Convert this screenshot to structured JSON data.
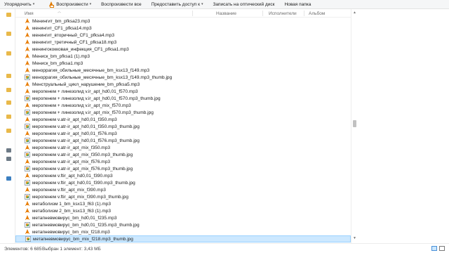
{
  "toolbar": {
    "organize": "Упорядочить",
    "play": "Воспроизвести",
    "play_all": "Воспроизвести все",
    "share": "Предоставить доступ к",
    "burn": "Записать на оптический диск",
    "new_folder": "Новая папка"
  },
  "columns": {
    "name": "Имя",
    "name2": "Название",
    "performers": "Исполнители",
    "album": "Альбом"
  },
  "files": [
    {
      "name": "Менингит_bm_pfksa23.mp3",
      "type": "mp3"
    },
    {
      "name": "менингит_CF1_pfksa14.mp3",
      "type": "mp3"
    },
    {
      "name": "менингит_вторичный_CF1_pfksa4.mp3",
      "type": "mp3"
    },
    {
      "name": "менингит_третичный_CF1_pfksa18.mp3",
      "type": "mp3"
    },
    {
      "name": "менингококковая_инфекция_CF1_pfksa1.mp3",
      "type": "mp3"
    },
    {
      "name": "Мениск_bm_pfksa1 (1).mp3",
      "type": "mp3"
    },
    {
      "name": "Мениск_bm_pfksa1.mp3",
      "type": "mp3"
    },
    {
      "name": "меноррагия_обильные_месячные_bm_ksx13_f149.mp3",
      "type": "mp3"
    },
    {
      "name": "меноррагия_обильные_месячные_bm_ksx13_f149.mp3_thumb.jpg",
      "type": "jpg"
    },
    {
      "name": "Менструальный_цикл_нарушение_bm_pfksa5.mp3",
      "type": "mp3"
    },
    {
      "name": "меропенем + линезолид v.ir_apt_hd0,01_f570.mp3",
      "type": "mp3"
    },
    {
      "name": "меропенем + линезолид v.ir_apt_hd0,01_f570.mp3_thumb.jpg",
      "type": "jpg"
    },
    {
      "name": "меропенем + линезолид v.ir_apt_mix_f570.mp3",
      "type": "mp3"
    },
    {
      "name": "меропенем + линезолид v.ir_apt_mix_f570.mp3_thumb.jpg",
      "type": "jpg"
    },
    {
      "name": "меропенем v.atr-ir_apt_hd0,01_f350.mp3",
      "type": "mp3"
    },
    {
      "name": "меропенем v.atr-ir_apt_hd0,01_f350.mp3_thumb.jpg",
      "type": "jpg"
    },
    {
      "name": "меропенем v.atr-ir_apt_hd0,01_f576.mp3",
      "type": "mp3"
    },
    {
      "name": "меропенем v.atr-ir_apt_hd0,01_f576.mp3_thumb.jpg",
      "type": "jpg"
    },
    {
      "name": "меропенем v.atr-ir_apt_mix_f350.mp3",
      "type": "mp3"
    },
    {
      "name": "меропенем v.atr-ir_apt_mix_f350.mp3_thumb.jpg",
      "type": "jpg"
    },
    {
      "name": "меропенем v.atr-ir_apt_mix_f576.mp3",
      "type": "mp3"
    },
    {
      "name": "меропенем v.atr-ir_apt_mix_f576.mp3_thumb.jpg",
      "type": "jpg"
    },
    {
      "name": "меропенем v.ftir_apt_hd0,01_f390.mp3",
      "type": "mp3"
    },
    {
      "name": "меропенем v.ftir_apt_hd0,01_f390.mp3_thumb.jpg",
      "type": "jpg"
    },
    {
      "name": "меропенем v.ftir_apt_mix_f390.mp3",
      "type": "mp3"
    },
    {
      "name": "меропенем v.ftir_apt_mix_f390.mp3_thumb.jpg",
      "type": "jpg"
    },
    {
      "name": "метаболизм 1_bm_ksx13_f63 (1).mp3",
      "type": "mp3"
    },
    {
      "name": "метаболизм 2_bm_ksx13_f63 (1).mp3",
      "type": "mp3"
    },
    {
      "name": "метапневмовирус_bm_hd0,01_f235.mp3",
      "type": "mp3"
    },
    {
      "name": "метапневмовирус_bm_hd0,01_f235.mp3_thumb.jpg",
      "type": "jpg"
    },
    {
      "name": "метапневмовирус_bm_mix_f218.mp3",
      "type": "mp3"
    },
    {
      "name": "метапневмовирус_bm_mix_f218.mp3_thumb.jpg",
      "type": "jpg",
      "selected": true
    }
  ],
  "status": {
    "count": "Элементов: 6 685",
    "selected": "Выбран 1 элемент: 3,43 МБ"
  },
  "colors": {
    "selection_bg": "#cce8ff",
    "selection_border": "#99d1ff",
    "mp3_icon": "#e8800c"
  }
}
